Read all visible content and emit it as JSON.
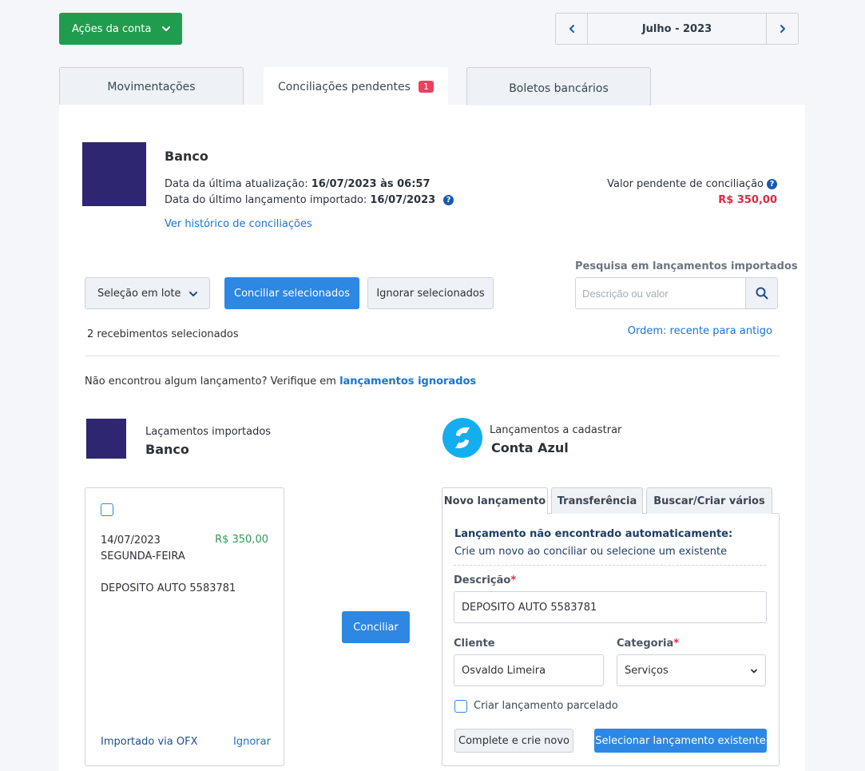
{
  "top": {
    "account_actions": "Ações da conta",
    "month_label": "Julho - 2023"
  },
  "tabs": [
    {
      "label": "Movimentações"
    },
    {
      "label": "Conciliações pendentes",
      "badge": "1"
    },
    {
      "label": "Boletos bancários"
    }
  ],
  "bank": {
    "name": "Banco",
    "last_update_label": "Data da última atualização:",
    "last_update_value": "16/07/2023 às 06:57",
    "last_import_label": "Data do último lançamento importado:",
    "last_import_value": "16/07/2023",
    "history_link": "Ver histórico de conciliações",
    "pending_label": "Valor pendente de conciliação",
    "pending_value": "R$ 350,00"
  },
  "toolbar": {
    "batch_select": "Seleção em lote",
    "reconcile_selected": "Conciliar selecionados",
    "ignore_selected": "Ignorar selecionados",
    "search_label": "Pesquisa em lançamentos importados",
    "search_placeholder": "Descrição ou valor",
    "selected_count": "2 recebimentos selecionados",
    "order": "Ordem: recente para antigo"
  },
  "ignored": {
    "text": "Não encontrou algum lançamento? Verifique em",
    "link": "lançamentos ignorados"
  },
  "columns": {
    "imported_label": "Laçamentos importados",
    "imported_bank": "Banco",
    "to_register_label": "Lançamentos a cadastrar",
    "to_register_name": "Conta Azul"
  },
  "transaction": {
    "date": "14/07/2023",
    "weekday": "SEGUNDA-FEIRA",
    "amount": "R$ 350,00",
    "description": "DEPOSITO AUTO 5583781",
    "imported_via": "Importado via OFX",
    "ignore": "Ignorar"
  },
  "reconcile_button": "Conciliar",
  "form": {
    "tabs": [
      {
        "label": "Novo lançamento"
      },
      {
        "label": "Transferência"
      },
      {
        "label": "Buscar/Criar vários"
      }
    ],
    "notice_title": "Lançamento não encontrado automaticamente:",
    "notice_sub": "Crie um novo ao conciliar ou selecione um existente",
    "description_label": "Descrição",
    "description_value": "DEPOSITO AUTO 5583781",
    "client_label": "Cliente",
    "client_value": "Osvaldo Limeira",
    "category_label": "Categoria",
    "category_value": "Serviços",
    "installment_label": "Criar lançamento parcelado",
    "complete_button": "Complete e crie novo",
    "select_existing_button": "Selecionar lançamento existente"
  },
  "colors": {
    "green": "#1f9c4e",
    "blue": "#2d87e3",
    "red": "#e0283f",
    "bank_logo": "#2e2670",
    "conta_azul_logo": "#14aef0"
  }
}
